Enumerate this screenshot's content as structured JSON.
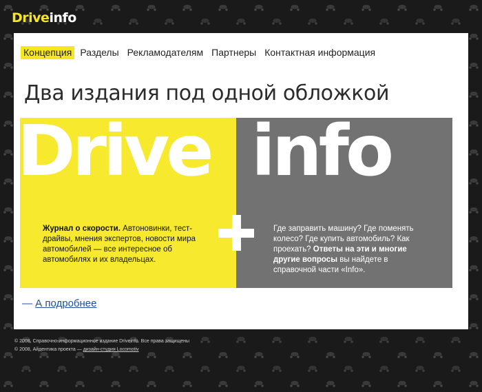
{
  "logo": {
    "part1": "Drive",
    "part2": "info"
  },
  "nav": {
    "items": [
      "Концепция",
      "Разделы",
      "Рекламодателям",
      "Партнеры",
      "Контактная информация"
    ],
    "active_index": 0
  },
  "headline": "Два издания под одной обложкой",
  "banner": {
    "left_word": "Drive",
    "right_word": "info",
    "left_bold": "Журнал о скорости.",
    "left_text": " Автоновинки, тест-драйвы, мнения экспертов, новости мира автомобилей — все интересное об автомобилях и их владельцах.",
    "right_text1": "Где заправить машину? Где поменять колесо? Где купить автомобиль? Как проехать? ",
    "right_bold": "Ответы на эти и многие другие вопросы",
    "right_text2": " вы найдете в справочной части «Info»."
  },
  "more": {
    "dash": "— ",
    "link": "А подробнее"
  },
  "footer": {
    "line1": "© 2008, Справочно-информационное издание Driveinfo. Все права защищены",
    "line2_prefix": "© 2008, Айдентика проекта — ",
    "line2_link": "дизайн-студия Locomotiv"
  },
  "colors": {
    "yellow": "#f7ea2e",
    "gray": "#727272",
    "link": "#1f4fa3"
  }
}
